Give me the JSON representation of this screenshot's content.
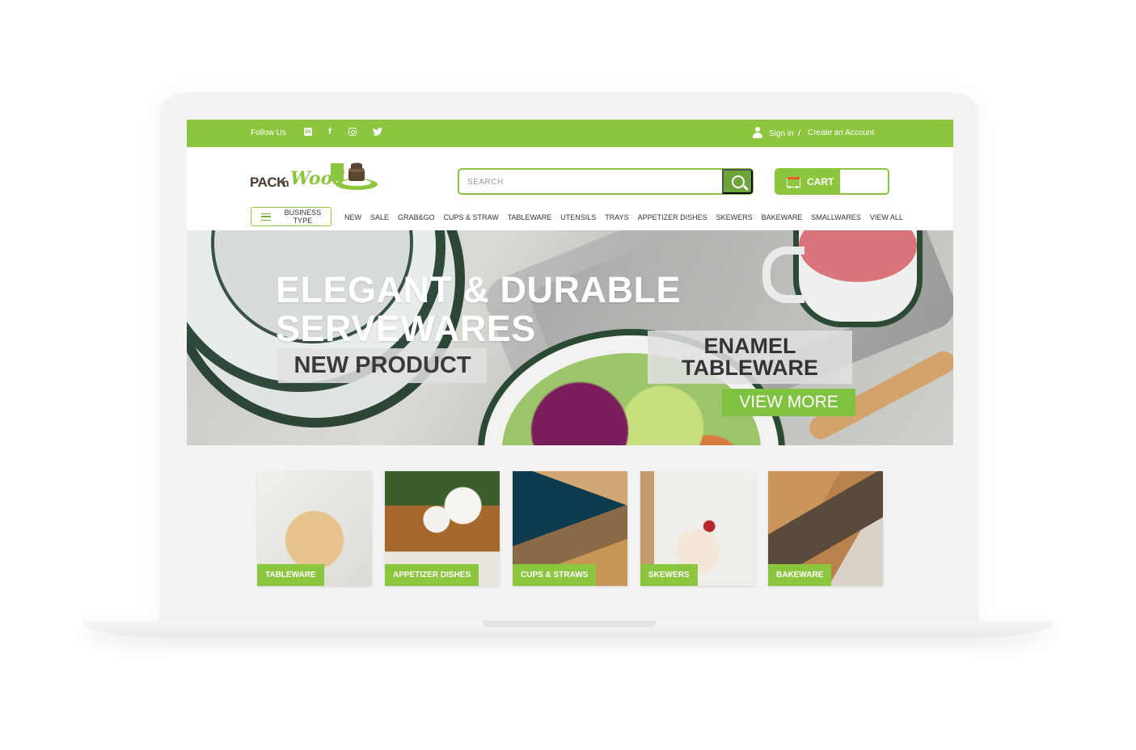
{
  "topbar": {
    "follow_label": "Follow Us",
    "social": [
      "linkedin-icon",
      "facebook-icon",
      "instagram-icon",
      "twitter-icon"
    ],
    "signin_label": "Sign in",
    "separator": "/",
    "create_account_label": "Create an Account"
  },
  "header": {
    "logo_pack": "PACK",
    "logo_n": "n",
    "logo_wood": "Wood",
    "search_placeholder": "SEARCH",
    "cart_label": "CART"
  },
  "nav": {
    "business_type_label": "BUSINESS TYPE",
    "items": [
      "NEW",
      "SALE",
      "GRAB&GO",
      "CUPS & STRAW",
      "TABLEWARE",
      "UTENSILS",
      "TRAYS",
      "APPETIZER DISHES",
      "SKEWERS",
      "BAKEWARE",
      "SMALLWARES",
      "VIEW ALL"
    ]
  },
  "hero": {
    "headline_line1": "ELEGANT & DURABLE",
    "headline_line2": "SERVEWARES",
    "new_product_label": "NEW PRODUCT",
    "enamel_line1": "ENAMEL",
    "enamel_line2": "TABLEWARE",
    "view_more_label": "VIEW MORE"
  },
  "categories": [
    {
      "label": "TABLEWARE"
    },
    {
      "label": "APPETIZER DISHES"
    },
    {
      "label": "CUPS & STRAWS"
    },
    {
      "label": "SKEWERS"
    },
    {
      "label": "BAKEWARE"
    }
  ],
  "colors": {
    "brand_green": "#8cc63f",
    "dark_green": "#6da43a",
    "logo_brown": "#4b3b2e"
  }
}
